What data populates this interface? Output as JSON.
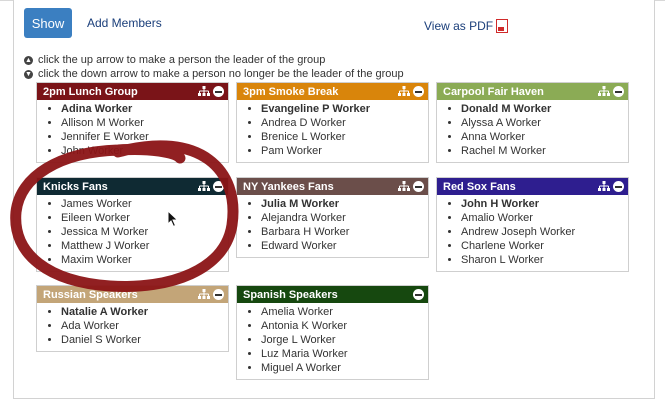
{
  "toolbar": {
    "show_label": "Show",
    "add_members_label": "Add Members",
    "view_pdf_label": "View as PDF"
  },
  "instructions": [
    "click the up arrow to make a person the leader of the group",
    "click the down arrow to make a person no longer be the leader of the group"
  ],
  "groups": [
    {
      "name": "2pm Lunch Group",
      "color": "#7a1418",
      "members": [
        "Adina Worker",
        "Allison M Worker",
        "Jennifer E Worker",
        "John Worker"
      ]
    },
    {
      "name": "3pm Smoke Break",
      "color": "#d9850b",
      "members": [
        "Evangeline P Worker",
        "Andrea D Worker",
        "Brenice L Worker",
        "Pam Worker"
      ]
    },
    {
      "name": "Carpool Fair Haven",
      "color": "#8bab55",
      "members": [
        "Donald M Worker",
        "Alyssa A Worker",
        "Anna Worker",
        "Rachel M Worker"
      ]
    },
    {
      "name": "Knicks Fans",
      "color": "#0f2a33",
      "members": [
        "James Worker",
        "Eileen Worker",
        "Jessica M Worker",
        "Matthew J Worker",
        "Maxim Worker"
      ]
    },
    {
      "name": "NY Yankees Fans",
      "color": "#6b4e4a",
      "members": [
        "Julia M Worker",
        "Alejandra Worker",
        "Barbara H Worker",
        "Edward Worker"
      ]
    },
    {
      "name": "Red Sox Fans",
      "color": "#2e1e8f",
      "members": [
        "John H Worker",
        "Amalio Worker",
        "Andrew Joseph Worker",
        "Charlene Worker",
        "Sharon L Worker"
      ]
    },
    {
      "name": "Russian Speakers",
      "color": "#c3a578",
      "members": [
        "Natalie A Worker",
        "Ada Worker",
        "Daniel S Worker"
      ]
    },
    {
      "name": "Spanish Speakers",
      "color": "#16480f",
      "members": [
        "Amelia Worker",
        "Antonia K Worker",
        "Jorge L Worker",
        "Luz Maria Worker",
        "Miguel A Worker"
      ]
    }
  ]
}
